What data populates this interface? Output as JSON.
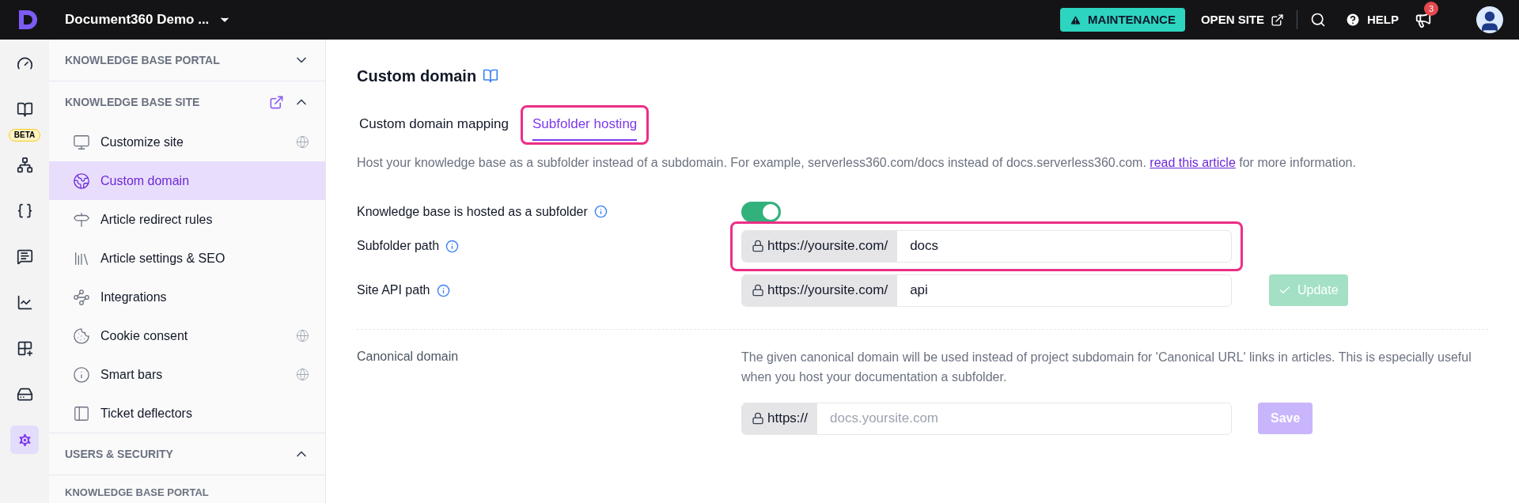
{
  "topbar": {
    "workspace": "Document360 Demo ...",
    "maintenance": "MAINTENANCE",
    "open_site": "OPEN SITE",
    "help": "HELP",
    "notifications": "3"
  },
  "rail": [
    {
      "kind": "dashboard",
      "selected": false
    },
    {
      "kind": "docs",
      "selected": false
    },
    {
      "kind": "workflow",
      "selected": false,
      "badge": "BETA"
    },
    {
      "kind": "api",
      "selected": false
    },
    {
      "kind": "feedback",
      "selected": false
    },
    {
      "kind": "analytics",
      "selected": false
    },
    {
      "kind": "apps",
      "selected": false
    },
    {
      "kind": "widget",
      "selected": false
    },
    {
      "kind": "settings",
      "selected": true
    }
  ],
  "sidebar": {
    "sections": [
      {
        "title": "KNOWLEDGE BASE PORTAL",
        "expanded": false,
        "external": false
      },
      {
        "title": "KNOWLEDGE BASE SITE",
        "expanded": true,
        "external": true,
        "items": [
          {
            "label": "Customize site",
            "kind": "monitor",
            "globe": true,
            "selected": false
          },
          {
            "label": "Custom domain",
            "kind": "earth",
            "globe": false,
            "selected": true
          },
          {
            "label": "Article redirect rules",
            "kind": "redirect",
            "globe": false,
            "selected": false
          },
          {
            "label": "Article settings & SEO",
            "kind": "library",
            "globe": false,
            "selected": false
          },
          {
            "label": "Integrations",
            "kind": "nodes",
            "globe": false,
            "selected": false
          },
          {
            "label": "Cookie consent",
            "kind": "cookie",
            "globe": true,
            "selected": false
          },
          {
            "label": "Smart bars",
            "kind": "info",
            "globe": true,
            "selected": false
          },
          {
            "label": "Ticket deflectors",
            "kind": "panel",
            "globe": false,
            "selected": false
          }
        ]
      },
      {
        "title": "USERS & SECURITY",
        "expanded": true,
        "external": false
      }
    ],
    "footer_heading": "KNOWLEDGE BASE PORTAL"
  },
  "page": {
    "title": "Custom domain",
    "tabs": [
      {
        "label": "Custom domain mapping",
        "selected": false,
        "highlighted": false
      },
      {
        "label": "Subfolder hosting",
        "selected": true,
        "highlighted": true
      }
    ],
    "description": "Host your knowledge base as a subfolder instead of a subdomain. For example, serverless360.com/docs instead of docs.serverless360.com.",
    "description_link": "read this article",
    "description_end": "for more information.",
    "rows": [
      {
        "kind": "toggle",
        "label": "Knowledge base is hosted as a subfolder",
        "on": true
      },
      {
        "kind": "path",
        "label": "Subfolder path",
        "prefix": "https://yoursite.com/",
        "value": "docs",
        "highlighted": true
      },
      {
        "kind": "path",
        "label": "Site API path",
        "prefix": "https://yoursite.com/",
        "value": "api",
        "highlighted": false,
        "button": "Update",
        "disabled": true
      }
    ],
    "canonical": {
      "label": "Canonical domain",
      "description": "The given canonical domain will be used instead of project subdomain for 'Canonical URL' links in articles. This is especially useful when you host your documentation a subfolder.",
      "prefix": "https://",
      "placeholder": "docs.yoursite.com",
      "button": "Save",
      "disabled": true
    }
  }
}
